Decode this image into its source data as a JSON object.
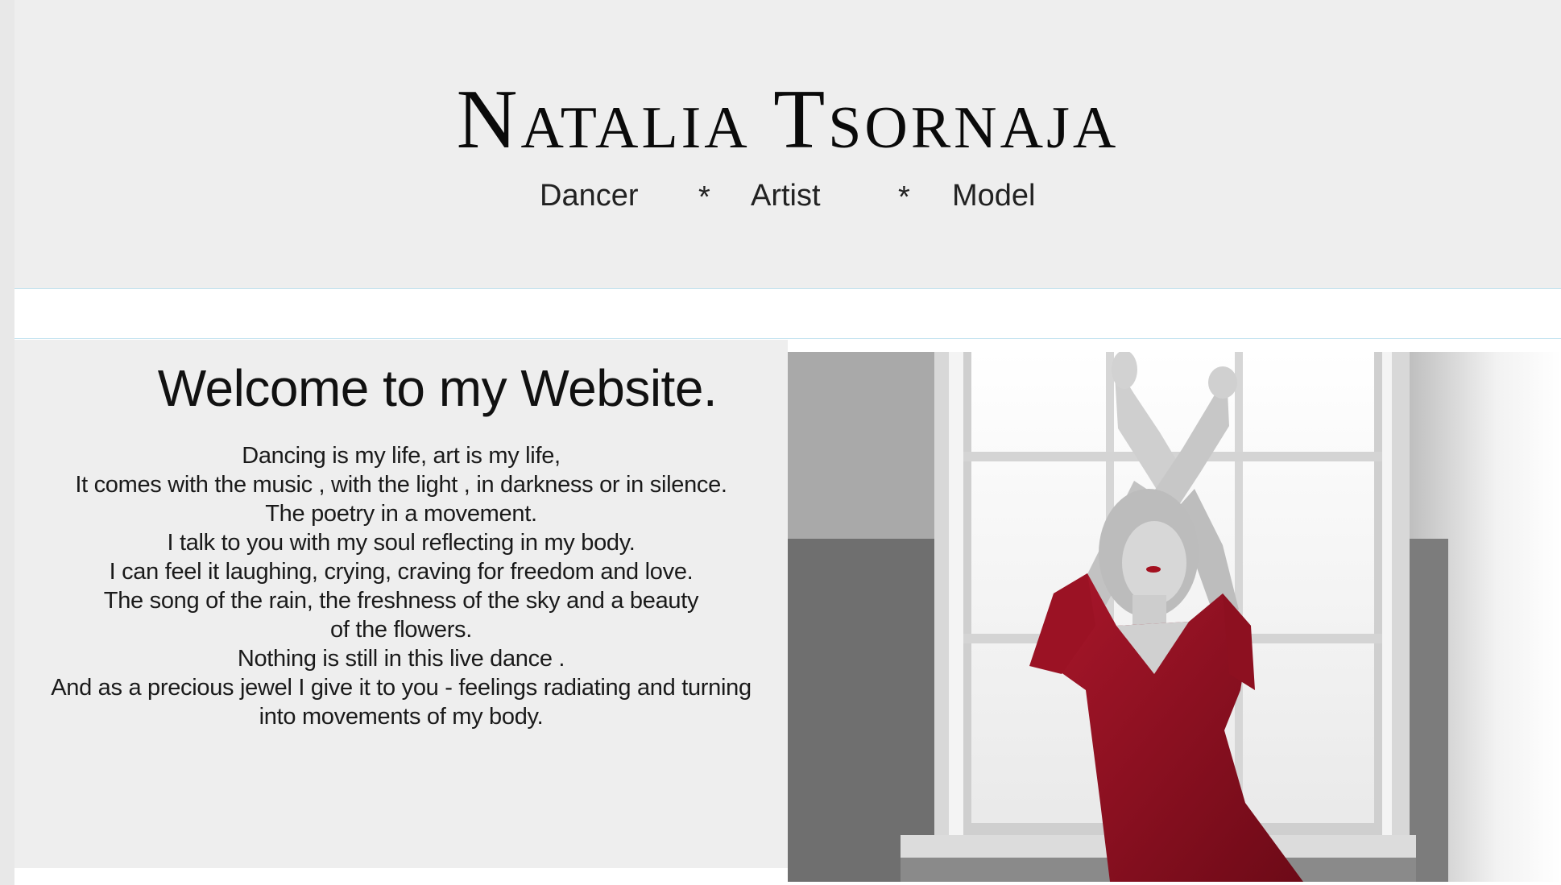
{
  "header": {
    "title": "Natalia Tsornaja",
    "roles": [
      "Dancer",
      "*",
      "Artist",
      "*",
      "Model"
    ]
  },
  "welcome": {
    "heading": "Welcome to my Website.",
    "poem_lines": [
      "Dancing is my life, art is my life,",
      "It comes with the music ,  with the light , in darkness or in silence.",
      "The poetry in a movement.",
      "I talk to you with my soul reflecting in my body.",
      "I can feel it laughing, crying,  craving for freedom  and love.",
      "The song of the rain, the freshness of the sky and  a beauty",
      "of the flowers.",
      "Nothing is still in this  live dance .",
      "And as a precious jewel I give it to you  - feelings radiating and turning",
      "into movements of my body."
    ]
  },
  "colors": {
    "header_bg": "#eeeeee",
    "divider": "#bfe1ee",
    "dress_red": "#8e1020"
  },
  "photo": {
    "icon": "dancer-photo"
  }
}
